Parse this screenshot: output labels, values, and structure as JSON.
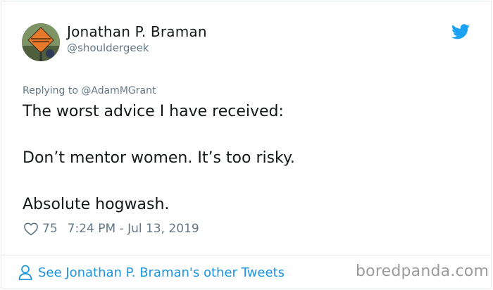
{
  "author": {
    "name": "Jonathan P. Braman",
    "handle": "@shouldergeek",
    "avatar_sign_text": "SHOULDER WORK"
  },
  "brand_icon": "twitter-bird-icon",
  "reply": {
    "text": "Replying to @AdamMGrant"
  },
  "tweet": {
    "lines": [
      "The worst advice I have received:",
      "Don’t mentor women. It’s too risky.",
      "Absolute hogwash."
    ],
    "likes": "75",
    "timestamp": "7:24 PM - Jul 13, 2019"
  },
  "footer": {
    "see_more": "See Jonathan P. Braman's other Tweets"
  },
  "watermark": "boredpanda.com",
  "colors": {
    "twitter_blue": "#1b95e0",
    "text": "#14171a",
    "muted": "#657786",
    "border": "#e1e8ed"
  }
}
